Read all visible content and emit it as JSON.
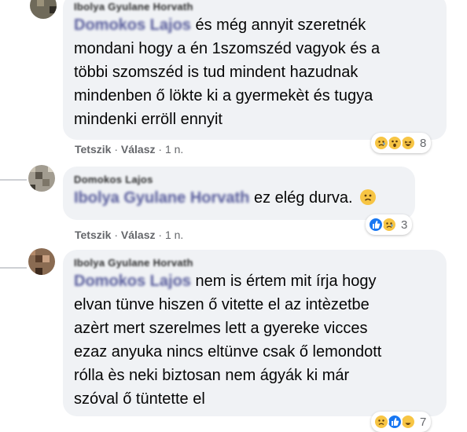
{
  "comments": [
    {
      "author": "Ibolya Gyulane Horvath",
      "mention": "Domokos Lajos",
      "text": [
        " és még annyit szeretnék",
        "mondani hogy a én 1szomszéd vagyok és a",
        "többi szomszéd is tud mindent hazudnak",
        "mindenben ő lökte ki a gyermekèt és tugya",
        "mindenki erröll ennyit"
      ],
      "actions": {
        "like": "Tetszik",
        "reply": "Válasz",
        "time": "1 n."
      },
      "reactions": {
        "icons": [
          "sad-icon",
          "wow-icon",
          "haha-icon"
        ],
        "count": "8"
      }
    },
    {
      "author": "Domokos Lajos",
      "mention": "Ibolya Gyulane Horvath",
      "text": [
        " ez elég durva."
      ],
      "emoji": "sad-face-icon",
      "actions": {
        "like": "Tetszik",
        "reply": "Válasz",
        "time": "1 n."
      },
      "reactions": {
        "icons": [
          "like-icon",
          "sad-icon"
        ],
        "count": "3"
      }
    },
    {
      "author": "Ibolya Gyulane Horvath",
      "mention": "Domokos Lajos",
      "text": [
        " nem is értem mit írja hogy",
        "elvan tünve hiszen ő vitette el az intèzetbe",
        "azèrt mert szerelmes lett a gyereke vicces",
        "ezaz anyuka nincs eltünve csak ő lemondott",
        "rólla ès neki biztosan nem ágyák ki már",
        "szóval ő tüntette el"
      ],
      "actions": {
        "like": "Tetszik",
        "reply": "Válasz",
        "time": "1 n."
      },
      "reactions": {
        "icons": [
          "sad-icon",
          "like-icon",
          "haha-icon"
        ],
        "count": "7"
      }
    }
  ]
}
